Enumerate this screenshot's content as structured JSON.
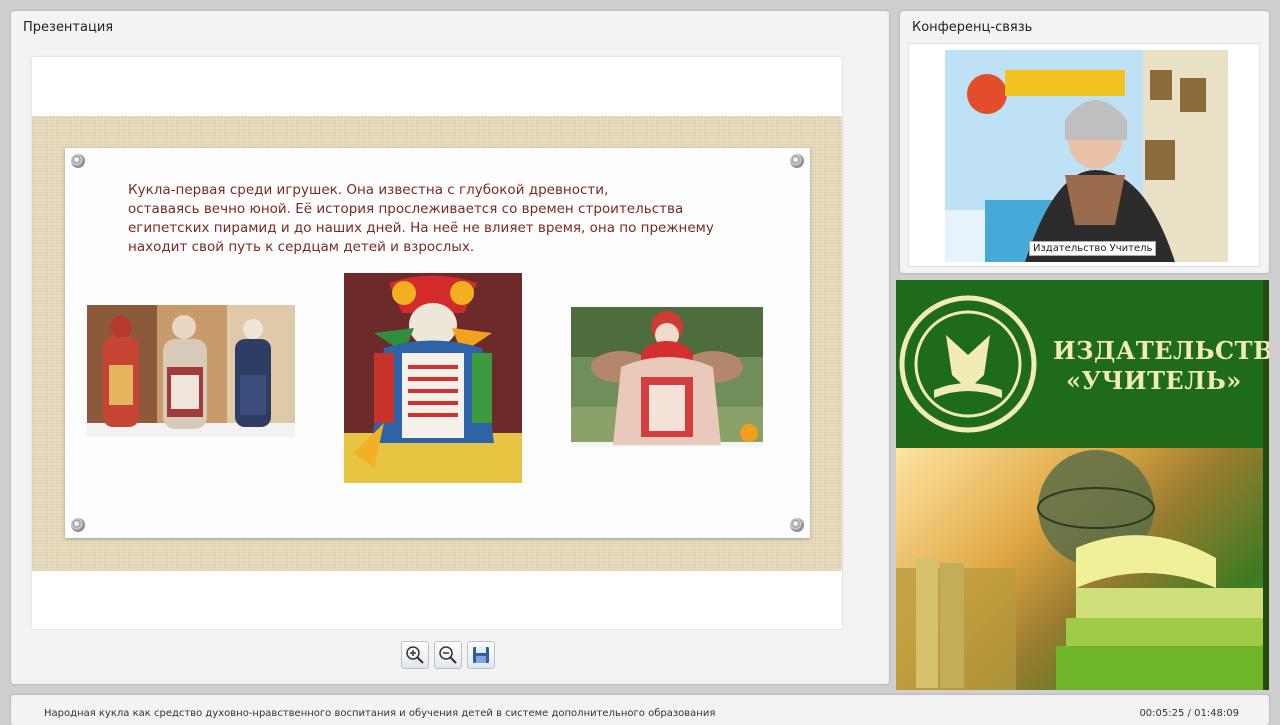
{
  "presentation": {
    "title": "Презентация",
    "slide": {
      "text": "Кукла-первая среди игрушек. Она известна с глубокой древности,\n оставаясь вечно юной. Её история прослеживается со времен строительства\nегипетских пирамид и до наших дней. На неё не влияет время, она по прежнему\nнаходит свой путь к сердцам детей и взрослых.",
      "text_color": "#7a2a24"
    },
    "toolbar": {
      "zoom_in_icon": "zoom-in-icon",
      "zoom_out_icon": "zoom-out-icon",
      "save_icon": "save-icon"
    }
  },
  "conference": {
    "title": "Конференц-связь",
    "video_caption": "Издательство Учитель"
  },
  "ad": {
    "line1": "ИЗДАТЕЛЬСТВО",
    "line2": "«УЧИТЕЛЬ»",
    "brand_color": "#1e6b1a"
  },
  "footer": {
    "title": "Народная кукла как средство духовно-нравственного воспитания и обучения детей в системе дополнительного образования",
    "time": "00:05:25 / 01:48:09"
  }
}
